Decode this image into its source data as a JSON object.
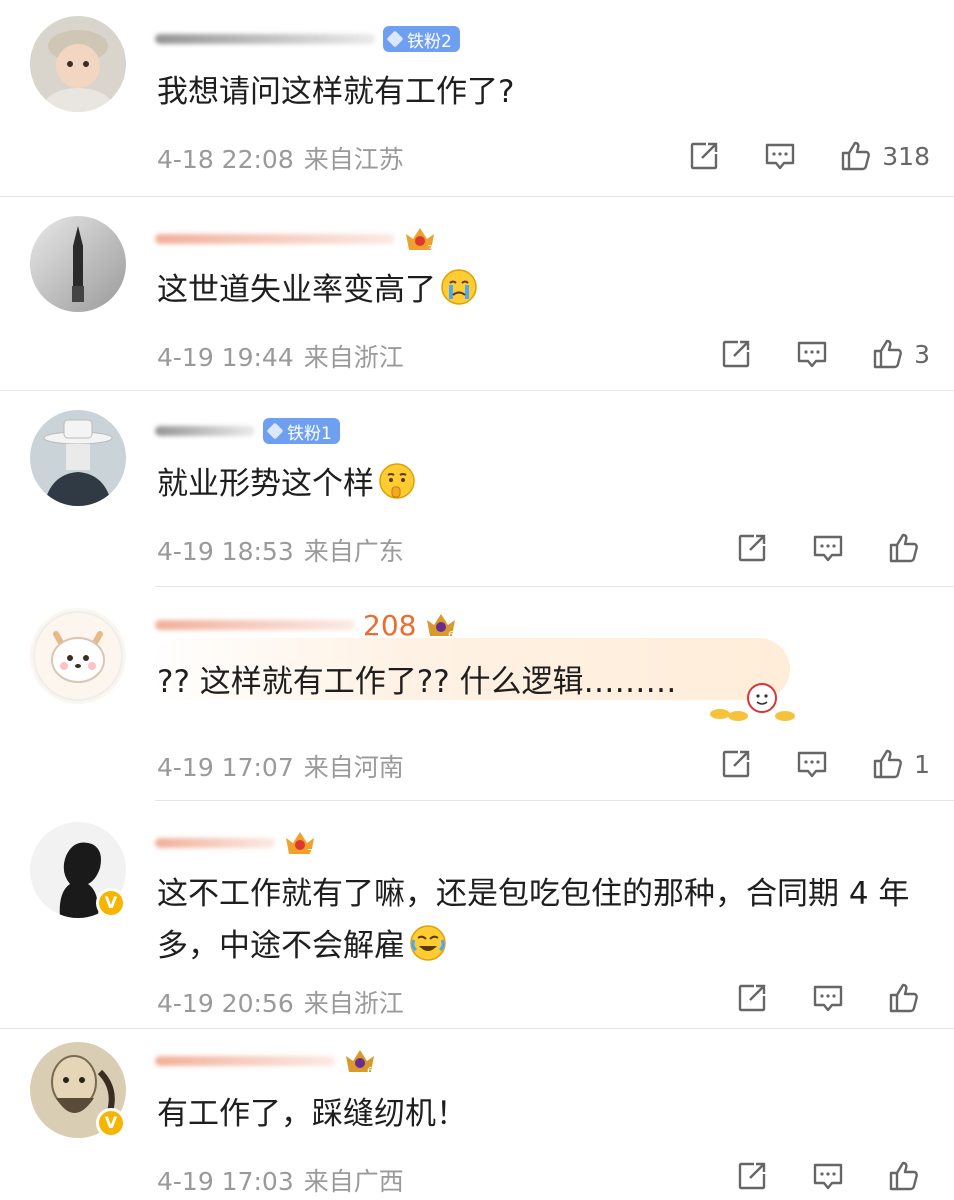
{
  "comments": [
    {
      "fan_badge": "铁粉2",
      "crown_level": "",
      "name_suffix": "",
      "text": "我想请问这样就有工作了?",
      "date": "4-18 22:08",
      "location": "来自江苏",
      "likes": "318",
      "verified": false,
      "emoji": ""
    },
    {
      "fan_badge": "",
      "crown_level": "3",
      "name_suffix": "",
      "text": "这世道失业率变高了",
      "date": "4-19 19:44",
      "location": "来自浙江",
      "likes": "3",
      "verified": false,
      "emoji": "crying-emoji"
    },
    {
      "fan_badge": "铁粉1",
      "crown_level": "",
      "name_suffix": "",
      "text": "就业形势这个样",
      "date": "4-19 18:53",
      "location": "来自广东",
      "likes": "",
      "verified": false,
      "emoji": "thinking-emoji"
    },
    {
      "fan_badge": "",
      "crown_level": "6",
      "name_suffix": "208",
      "text": "?? 这样就有工作了?? 什么逻辑………",
      "date": "4-19 17:07",
      "location": "来自河南",
      "likes": "1",
      "verified": false,
      "emoji": ""
    },
    {
      "fan_badge": "",
      "crown_level": "7",
      "name_suffix": "",
      "text": "这不工作就有了嘛，还是包吃包住的那种，合同期 4 年多，中途不会解雇",
      "date": "4-19 20:56",
      "location": "来自浙江",
      "likes": "",
      "verified": true,
      "emoji": "laugh-cry-emoji"
    },
    {
      "fan_badge": "",
      "crown_level": "6",
      "name_suffix": "",
      "text": "有工作了，踩缝纫机！",
      "date": "4-19 17:03",
      "location": "来自广西",
      "likes": "",
      "verified": true,
      "emoji": ""
    }
  ],
  "colors": {
    "meta_text": "#9a9a9a",
    "name_accent": "#ef6b2c",
    "fan_badge": "#6f9ff0",
    "verified_badge": "#f7b500"
  },
  "icons": [
    "share-icon",
    "comment-icon",
    "like-icon"
  ]
}
